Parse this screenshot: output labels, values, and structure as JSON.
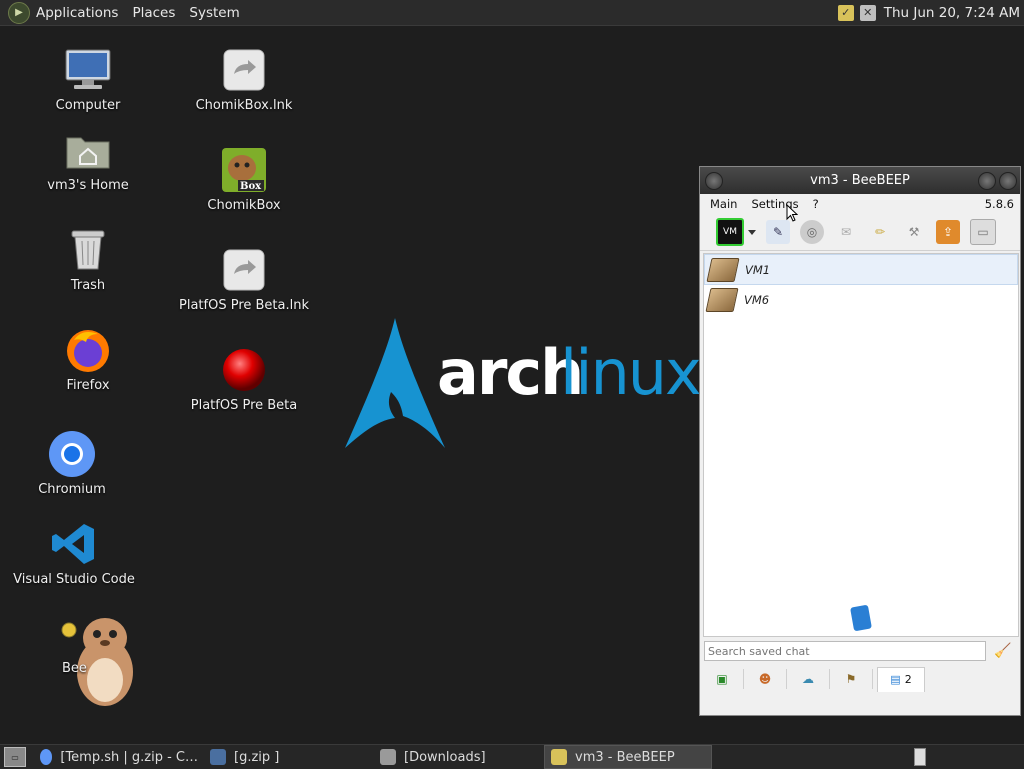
{
  "top_panel": {
    "menus": [
      "Applications",
      "Places",
      "System"
    ],
    "clock": "Thu Jun 20,  7:24 AM"
  },
  "desktop": {
    "icons": [
      {
        "label": "Computer",
        "icon": "computer-icon"
      },
      {
        "label": "vm3's Home",
        "icon": "home-folder-icon"
      },
      {
        "label": "Trash",
        "icon": "trash-icon"
      },
      {
        "label": "Firefox",
        "icon": "firefox-icon"
      },
      {
        "label": "Chromium",
        "icon": "chromium-icon"
      },
      {
        "label": "Visual Studio Code",
        "icon": "vscode-icon"
      },
      {
        "label": "Bee",
        "icon": "beebeep-icon"
      },
      {
        "label": "ChomikBox.lnk",
        "icon": "shortcut-icon"
      },
      {
        "label": "ChomikBox",
        "icon": "chomikbox-icon"
      },
      {
        "label": "PlatfOS Pre Beta.lnk",
        "icon": "shortcut-icon"
      },
      {
        "label": "PlatfOS Pre Beta",
        "icon": "red-ball-icon"
      }
    ],
    "wallpaper": {
      "word1": "arch",
      "word2": "linux",
      "accent": "#1793d1"
    }
  },
  "beebeep": {
    "title": "vm3 - BeeBEEP",
    "menu": [
      "Main",
      "Settings",
      "?"
    ],
    "version": "5.8.6",
    "users": [
      "VM1",
      "VM6"
    ],
    "search_placeholder": "Search saved chat",
    "tab_count": "2"
  },
  "taskbar": {
    "tasks": [
      "[Temp.sh | g.zip - C…",
      "[g.zip ]",
      "[Downloads]",
      "vm3 - BeeBEEP"
    ]
  }
}
